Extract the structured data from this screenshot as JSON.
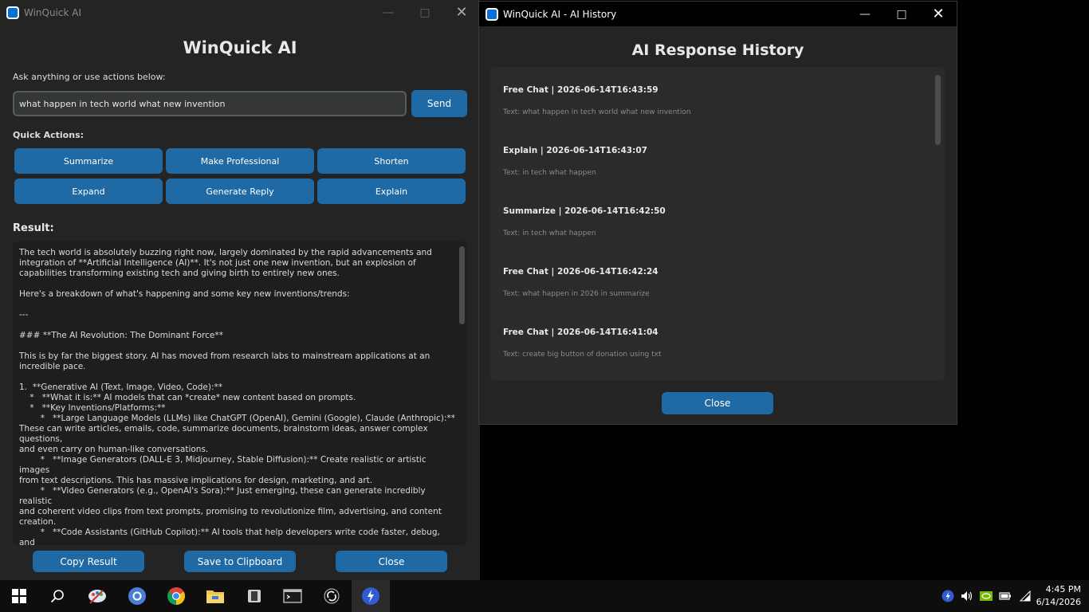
{
  "main_window": {
    "title": "WinQuick AI",
    "app_title": "WinQuick AI",
    "ask_label": "Ask anything or use actions below:",
    "query_value": "what happen in tech world what new invention",
    "send_label": "Send",
    "quick_actions_label": "Quick Actions:",
    "quick_actions": [
      "Summarize",
      "Make Professional",
      "Shorten",
      "Expand",
      "Generate Reply",
      "Explain"
    ],
    "result_label": "Result:",
    "result_text": "The tech world is absolutely buzzing right now, largely dominated by the rapid advancements and\nintegration of **Artificial Intelligence (AI)**. It's not just one new invention, but an explosion of\ncapabilities transforming existing tech and giving birth to entirely new ones.\n\nHere's a breakdown of what's happening and some key new inventions/trends:\n\n---\n\n### **The AI Revolution: The Dominant Force**\n\nThis is by far the biggest story. AI has moved from research labs to mainstream applications at an\nincredible pace.\n\n1.  **Generative AI (Text, Image, Video, Code):**\n    *   **What it is:** AI models that can *create* new content based on prompts.\n    *   **Key Inventions/Platforms:**\n        *   **Large Language Models (LLMs) like ChatGPT (OpenAI), Gemini (Google), Claude (Anthropic):**\nThese can write articles, emails, code, summarize documents, brainstorm ideas, answer complex questions,\nand even carry on human-like conversations.\n        *   **Image Generators (DALL-E 3, Midjourney, Stable Diffusion):** Create realistic or artistic images\nfrom text descriptions. This has massive implications for design, marketing, and art.\n        *   **Video Generators (e.g., OpenAI's Sora):** Just emerging, these can generate incredibly realistic\nand coherent video clips from text prompts, promising to revolutionize film, advertising, and content\ncreation.\n        *   **Code Assistants (GitHub Copilot):** AI tools that help developers write code faster, debug, and\neven generate entire functions.\n    *   **Impact:** Revolutionizing productivity, creativity, content creation, software development, and\ninformation access.",
    "copy_label": "Copy Result",
    "save_label": "Save to Clipboard",
    "close_label": "Close"
  },
  "history_window": {
    "title": "WinQuick AI - AI History",
    "heading": "AI Response History",
    "entries": [
      {
        "head": "Free Chat  |  2026-06-14T16:43:59",
        "text": "Text: what happen in tech world what new invention"
      },
      {
        "head": "Explain  |  2026-06-14T16:43:07",
        "text": "Text: in tech what happen"
      },
      {
        "head": "Summarize  |  2026-06-14T16:42:50",
        "text": "Text: in tech what happen"
      },
      {
        "head": "Free Chat  |  2026-06-14T16:42:24",
        "text": "Text: what happen in 2026 in summarize"
      },
      {
        "head": "Free Chat  |  2026-06-14T16:41:04",
        "text": "Text: create big button of donation using txt"
      }
    ],
    "close_label": "Close"
  },
  "taskbar": {
    "time": "4:45 PM",
    "date": "6/14/2026"
  }
}
